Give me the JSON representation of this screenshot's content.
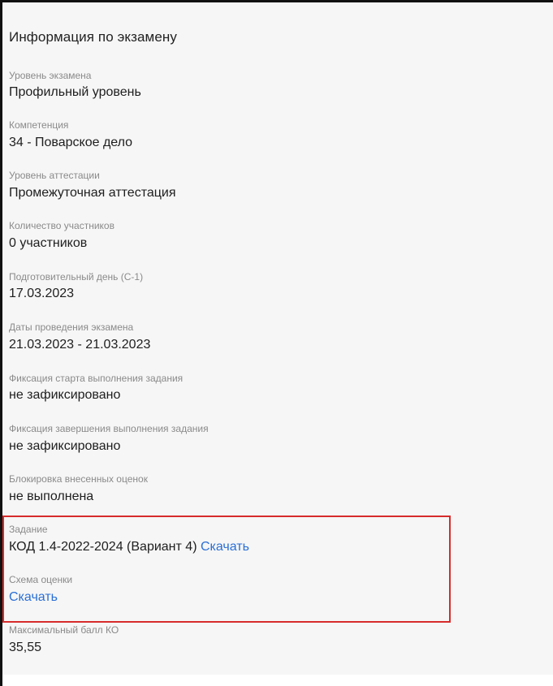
{
  "section": {
    "title": "Информация по экзамену"
  },
  "fields": {
    "exam_level": {
      "label": "Уровень экзамена",
      "value": "Профильный уровень"
    },
    "competence": {
      "label": "Компетенция",
      "value": "34 - Поварское дело"
    },
    "attestation_level": {
      "label": "Уровень аттестации",
      "value": "Промежуточная аттестация"
    },
    "participants_count": {
      "label": "Количество участников",
      "value": "0 участников"
    },
    "prep_day": {
      "label": "Подготовительный день (С-1)",
      "value": "17.03.2023"
    },
    "exam_dates": {
      "label": "Даты проведения экзамена",
      "value": "21.03.2023 - 21.03.2023"
    },
    "start_fix": {
      "label": "Фиксация старта выполнения задания",
      "value": "не зафиксировано"
    },
    "end_fix": {
      "label": "Фиксация завершения выполнения задания",
      "value": "не зафиксировано"
    },
    "grades_lock": {
      "label": "Блокировка внесенных оценок",
      "value": "не выполнена"
    },
    "task": {
      "label": "Задание",
      "value": "КОД 1.4-2022-2024 (Вариант 4)",
      "link": "Скачать"
    },
    "grading_scheme": {
      "label": "Схема оценки",
      "link": "Скачать"
    },
    "max_score": {
      "label": "Максимальный балл КО",
      "value": "35,55"
    }
  },
  "colors": {
    "link": "#2a6fd6",
    "highlight_border": "#d72b2b",
    "label": "#8a8a8a",
    "value": "#1e1e1e"
  }
}
